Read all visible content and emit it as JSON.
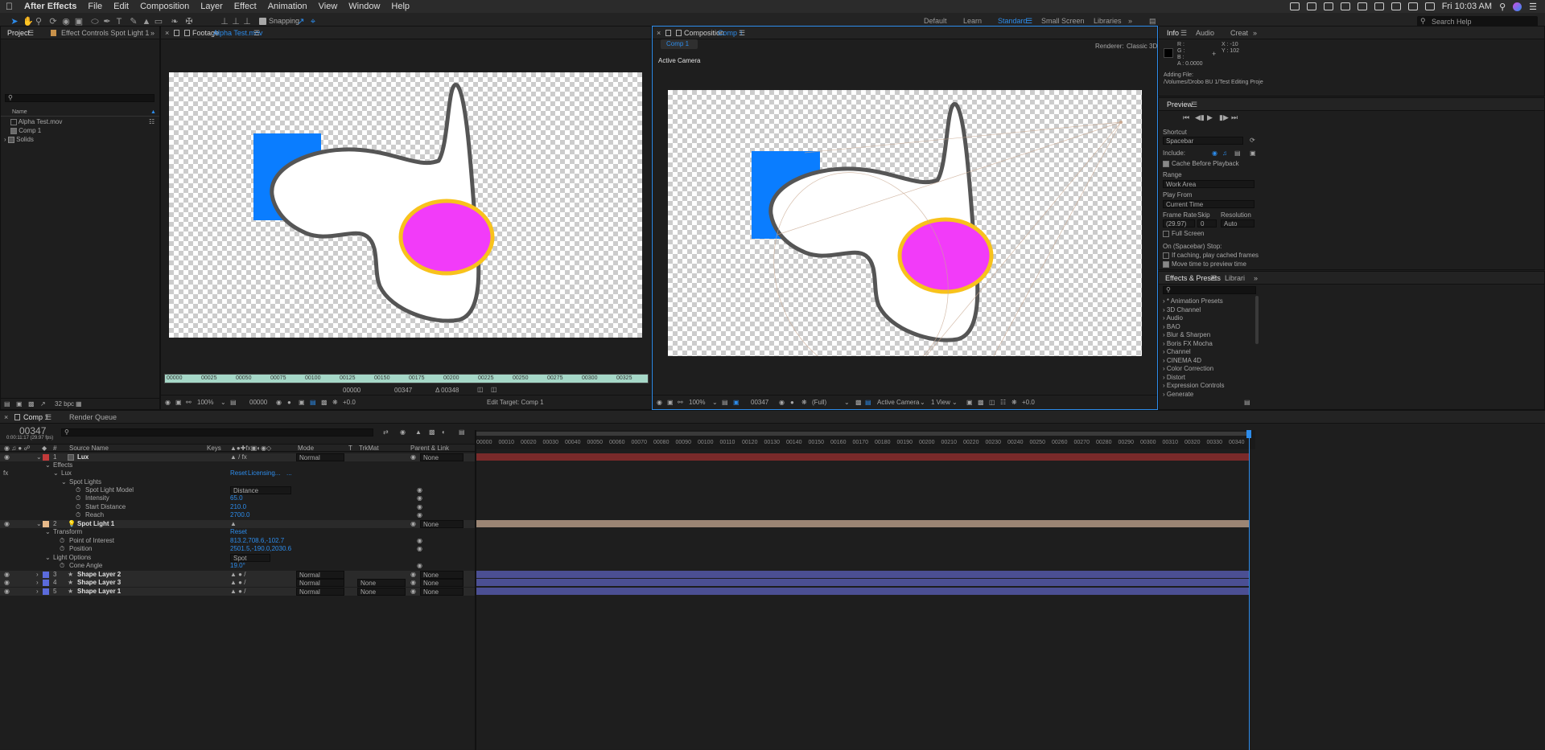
{
  "menubar": {
    "app": "After Effects",
    "items": [
      "File",
      "Edit",
      "Composition",
      "Layer",
      "Effect",
      "Animation",
      "View",
      "Window",
      "Help"
    ],
    "clock": "Fri 10:03 AM"
  },
  "toolbar": {
    "snapping": "Snapping",
    "workspaces": [
      "Default",
      "Learn",
      "Standard",
      "Small Screen",
      "Libraries"
    ],
    "active_workspace": "Standard",
    "search": "Search Help"
  },
  "project": {
    "tab": "Project",
    "effect_controls_tab": "Effect Controls Spot Light 1",
    "column_name": "Name",
    "items": [
      "Alpha Test.mov",
      "Comp 1",
      "Solids"
    ],
    "bpc": "32 bpc"
  },
  "footage": {
    "tab_prefix": "Footage",
    "tab_name": "Alpha Test.mov",
    "ruler": [
      "00000",
      "00025",
      "00050",
      "00075",
      "00100",
      "00125",
      "00150",
      "00175",
      "00200",
      "00225",
      "00250",
      "00275",
      "00300",
      "00325"
    ],
    "zoom": "100%",
    "timecode": "00000",
    "in": "00000",
    "out": "00347",
    "duration": "Δ 00348",
    "offset": "+0.0",
    "edit_target": "Edit Target: Comp 1"
  },
  "composition": {
    "tab_prefix": "Composition",
    "tab_name": "Comp 1",
    "subtab": "Comp 1",
    "renderer_label": "Renderer:",
    "renderer": "Classic 3D",
    "camera_label": "Active Camera",
    "zoom": "100%",
    "timecode": "00347",
    "resolution": "(Full)",
    "camera": "Active Camera",
    "views": "1 View",
    "offset": "+0.0"
  },
  "info": {
    "tabs": [
      "Info",
      "Audio",
      "Creat"
    ],
    "rgb": [
      "R :",
      "G :",
      "B :",
      "A : 0.0000"
    ],
    "x": "X : -10",
    "y": "Y : 102",
    "adding_label": "Adding File:",
    "adding_path": "/Volumes/Drobo BU 1/Test Editing Proje"
  },
  "preview": {
    "title": "Preview",
    "shortcut_label": "Shortcut",
    "shortcut": "Spacebar",
    "include_label": "Include:",
    "cache": "Cache Before Playback",
    "range_label": "Range",
    "range": "Work Area",
    "playfrom_label": "Play From",
    "playfrom": "Current Time",
    "fr_label": "Frame Rate",
    "skip_label": "Skip",
    "res_label": "Resolution",
    "fr": "(29.97)",
    "skip": "0",
    "res": "Auto",
    "fullscreen": "Full Screen",
    "stop_label": "On (Spacebar) Stop:",
    "if_caching": "If caching, play cached frames",
    "move_time": "Move time to preview time"
  },
  "effects": {
    "tabs": [
      "Effects & Presets",
      "Librari"
    ],
    "items": [
      "* Animation Presets",
      "3D Channel",
      "Audio",
      "BAO",
      "Blur & Sharpen",
      "Boris FX Mocha",
      "Channel",
      "CINEMA 4D",
      "Color Correction",
      "Distort",
      "Expression Controls",
      "Generate"
    ]
  },
  "timeline": {
    "tab": "Comp 1",
    "render_queue": "Render Queue",
    "timecode": "00347",
    "sub_timecode": "0:00:11:17 (29.97 fps)",
    "cols": {
      "num": "#",
      "source": "Source Name",
      "keys": "Keys",
      "mode": "Mode",
      "t": "T",
      "trkmat": "TrkMat",
      "parent": "Parent & Link"
    },
    "ruler": [
      "00000",
      "00010",
      "00020",
      "00030",
      "00040",
      "00050",
      "00060",
      "00070",
      "00080",
      "00090",
      "00100",
      "00110",
      "00120",
      "00130",
      "00140",
      "00150",
      "00160",
      "00170",
      "00180",
      "00190",
      "00200",
      "00210",
      "00220",
      "00230",
      "00240",
      "00250",
      "00260",
      "00270",
      "00280",
      "00290",
      "00300",
      "00310",
      "00320",
      "00330",
      "00340"
    ],
    "l1": {
      "num": "1",
      "name": "Lux",
      "mode": "Normal",
      "parent": "None"
    },
    "effects_label": "Effects",
    "lux": "Lux",
    "reset": "Reset",
    "licensing": "Licensing...",
    "dots": "...",
    "spot_lights": "Spot Lights",
    "slm": {
      "name": "Spot Light Model",
      "val": "Distance"
    },
    "intensity": {
      "name": "Intensity",
      "val": "65.0"
    },
    "start": {
      "name": "Start Distance",
      "val": "210.0"
    },
    "reach": {
      "name": "Reach",
      "val": "2700.0"
    },
    "l2": {
      "num": "2",
      "name": "Spot Light 1",
      "parent": "None"
    },
    "transform": "Transform",
    "poi": {
      "name": "Point of Interest",
      "val": "813.2,708.6,-102.7"
    },
    "pos": {
      "name": "Position",
      "val": "2501.5,-190.0,2030.6"
    },
    "light_options": "Light Options",
    "light_type": "Spot",
    "cone": {
      "name": "Cone Angle",
      "val": "19.0°"
    },
    "l3": {
      "num": "3",
      "name": "Shape Layer 2",
      "mode": "Normal",
      "parent": "None"
    },
    "l4": {
      "num": "4",
      "name": "Shape Layer 3",
      "mode": "Normal",
      "trk": "None",
      "parent": "None"
    },
    "l5": {
      "num": "5",
      "name": "Shape Layer 1",
      "mode": "Normal",
      "trk": "None",
      "parent": "None"
    }
  },
  "colors": {
    "accent": "#2d8ceb",
    "lux_bar": "#7a2a2a",
    "light_bar": "#9b8574",
    "shape_bar": "#4b4f93",
    "blue_square": "#0a7dff",
    "magenta": "#f23bf9",
    "ring": "#f8c21c"
  }
}
